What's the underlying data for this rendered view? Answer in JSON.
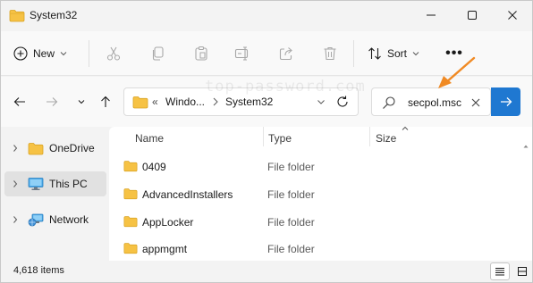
{
  "window": {
    "title": "System32",
    "controls": [
      "minimize-icon",
      "maximize-icon",
      "close-icon"
    ]
  },
  "commandbar": {
    "new_label": "New",
    "sort_label": "Sort",
    "more_label": "•••",
    "icons": [
      "cut-icon",
      "copy-icon",
      "paste-icon",
      "rename-icon",
      "share-icon",
      "delete-icon"
    ]
  },
  "address": {
    "overflow": "«",
    "segments": [
      "Windo...",
      "System32"
    ]
  },
  "search": {
    "value": "secpol.msc"
  },
  "watermark": "top-password.com",
  "annotation": {
    "color": "#f08a24"
  },
  "navpane": {
    "items": [
      {
        "label": "OneDrive",
        "icon": "folder-icon",
        "selected": false
      },
      {
        "label": "This PC",
        "icon": "computer-icon",
        "selected": true
      },
      {
        "label": "Network",
        "icon": "network-icon",
        "selected": false
      }
    ]
  },
  "filelist": {
    "columns": {
      "name": "Name",
      "type": "Type",
      "size": "Size"
    },
    "rows": [
      {
        "name": "0409",
        "type": "File folder"
      },
      {
        "name": "AdvancedInstallers",
        "type": "File folder"
      },
      {
        "name": "AppLocker",
        "type": "File folder"
      },
      {
        "name": "appmgmt",
        "type": "File folder"
      }
    ]
  },
  "status": {
    "item_count": "4,618 items",
    "views": [
      "details-view-icon",
      "tiles-view-icon"
    ]
  },
  "colors": {
    "accent": "#1f78d1",
    "folder": "#f6c244"
  }
}
